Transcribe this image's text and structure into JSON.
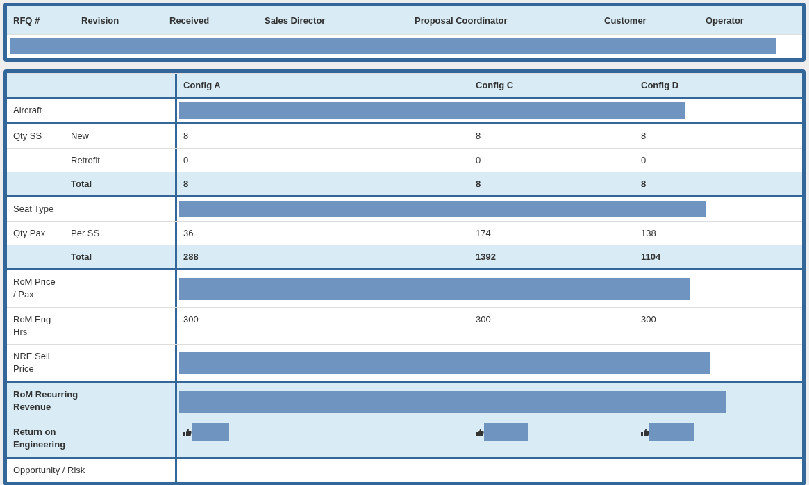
{
  "rfq_panel": {
    "columns": [
      "RFQ #",
      "Revision",
      "Received",
      "Sales Director",
      "Proposal Coordinator",
      "Customer",
      "Operator"
    ]
  },
  "config_table": {
    "columns": [
      "Config A",
      "Config C",
      "Config D"
    ],
    "sections": [
      {
        "emphasis": false,
        "rows": [
          {
            "kind": "redacted",
            "label_lines": [
              "Aircraft"
            ]
          }
        ]
      },
      {
        "emphasis": false,
        "rows": [
          {
            "kind": "values",
            "label_lines": [
              "Qty SS"
            ],
            "sublabel": "New",
            "values": [
              "8",
              "8",
              "8"
            ]
          },
          {
            "kind": "values",
            "sublabel": "Retrofit",
            "values": [
              "0",
              "0",
              "0"
            ]
          },
          {
            "kind": "total",
            "sublabel": "Total",
            "values": [
              "8",
              "8",
              "8"
            ]
          }
        ]
      },
      {
        "emphasis": false,
        "rows": [
          {
            "kind": "redacted",
            "label_lines": [
              "Seat Type"
            ]
          },
          {
            "kind": "values",
            "label_lines": [
              "Qty Pax"
            ],
            "sublabel": "Per SS",
            "values": [
              "36",
              "174",
              "138"
            ]
          },
          {
            "kind": "total",
            "sublabel": "Total",
            "values": [
              "288",
              "1392",
              "1104"
            ]
          }
        ]
      },
      {
        "emphasis": false,
        "rows": [
          {
            "kind": "redacted",
            "label_lines": [
              "RoM Price",
              "/ Pax"
            ]
          },
          {
            "kind": "values",
            "label_lines": [
              "RoM Eng",
              "Hrs"
            ],
            "values": [
              "300",
              "300",
              "300"
            ]
          },
          {
            "kind": "redacted",
            "label_lines": [
              "NRE Sell",
              "Price"
            ]
          }
        ]
      },
      {
        "emphasis": true,
        "rows": [
          {
            "kind": "redacted",
            "label_lines": [
              "RoM Recurring",
              "Revenue"
            ]
          },
          {
            "kind": "thumbs",
            "label_lines": [
              "Return on",
              "Engineering"
            ]
          }
        ]
      },
      {
        "emphasis": false,
        "rows": [
          {
            "kind": "empty",
            "label_lines": [
              "Opportunity / Risk"
            ]
          }
        ]
      }
    ]
  }
}
